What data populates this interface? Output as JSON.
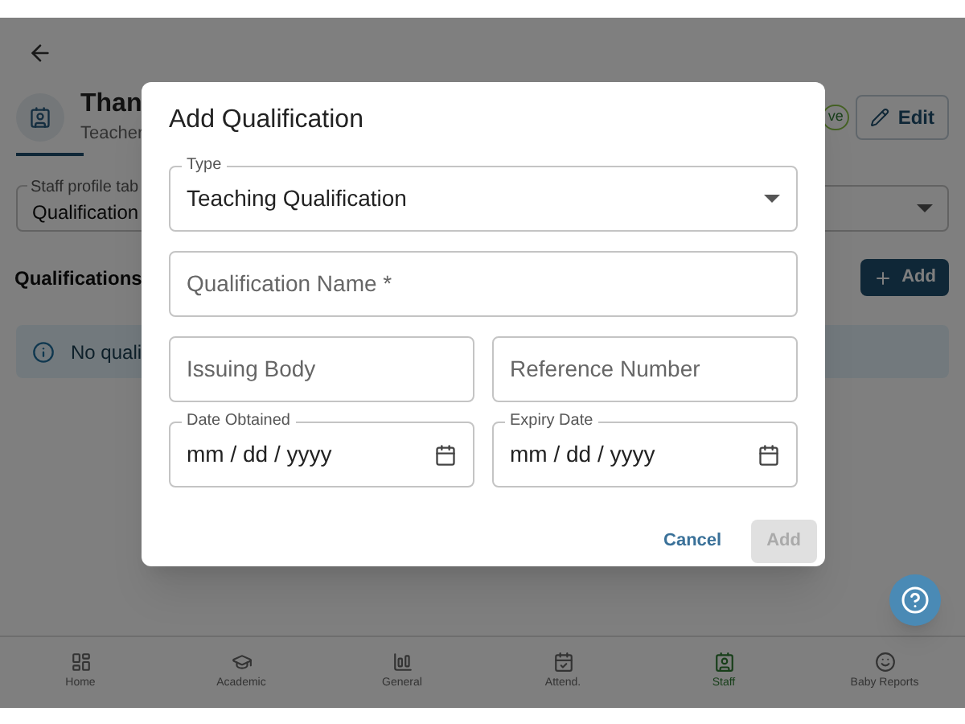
{
  "header": {
    "name": "Than",
    "role": "Teacher",
    "status_badge": "ve",
    "edit_button": "Edit"
  },
  "profile_tabs_select": {
    "label": "Staff profile tab",
    "value": "Qualification"
  },
  "section": {
    "title": "Qualifications",
    "add_button": "Add"
  },
  "alert": {
    "text": "No quali"
  },
  "bottom_nav": [
    {
      "label": "Home",
      "selected": false
    },
    {
      "label": "Academic",
      "selected": false
    },
    {
      "label": "General",
      "selected": false
    },
    {
      "label": "Attend.",
      "selected": false
    },
    {
      "label": "Staff",
      "selected": true
    },
    {
      "label": "Baby Reports",
      "selected": false
    }
  ],
  "dialog": {
    "title": "Add Qualification",
    "fields": [
      {
        "kind": "select",
        "label": "Type",
        "value": "Teaching Qualification"
      },
      {
        "kind": "text",
        "placeholder": "Qualification Name *"
      },
      {
        "kind": "text",
        "placeholder": "Issuing Body"
      },
      {
        "kind": "text",
        "placeholder": "Reference Number"
      },
      {
        "kind": "date",
        "label": "Date Obtained",
        "value": "mm / dd / yyyy"
      },
      {
        "kind": "date",
        "label": "Expiry Date",
        "value": "mm / dd / yyyy"
      }
    ],
    "buttons": [
      {
        "label": "Cancel",
        "disabled": false,
        "kind": "text"
      },
      {
        "label": "Add",
        "disabled": true,
        "kind": "contained"
      }
    ]
  }
}
